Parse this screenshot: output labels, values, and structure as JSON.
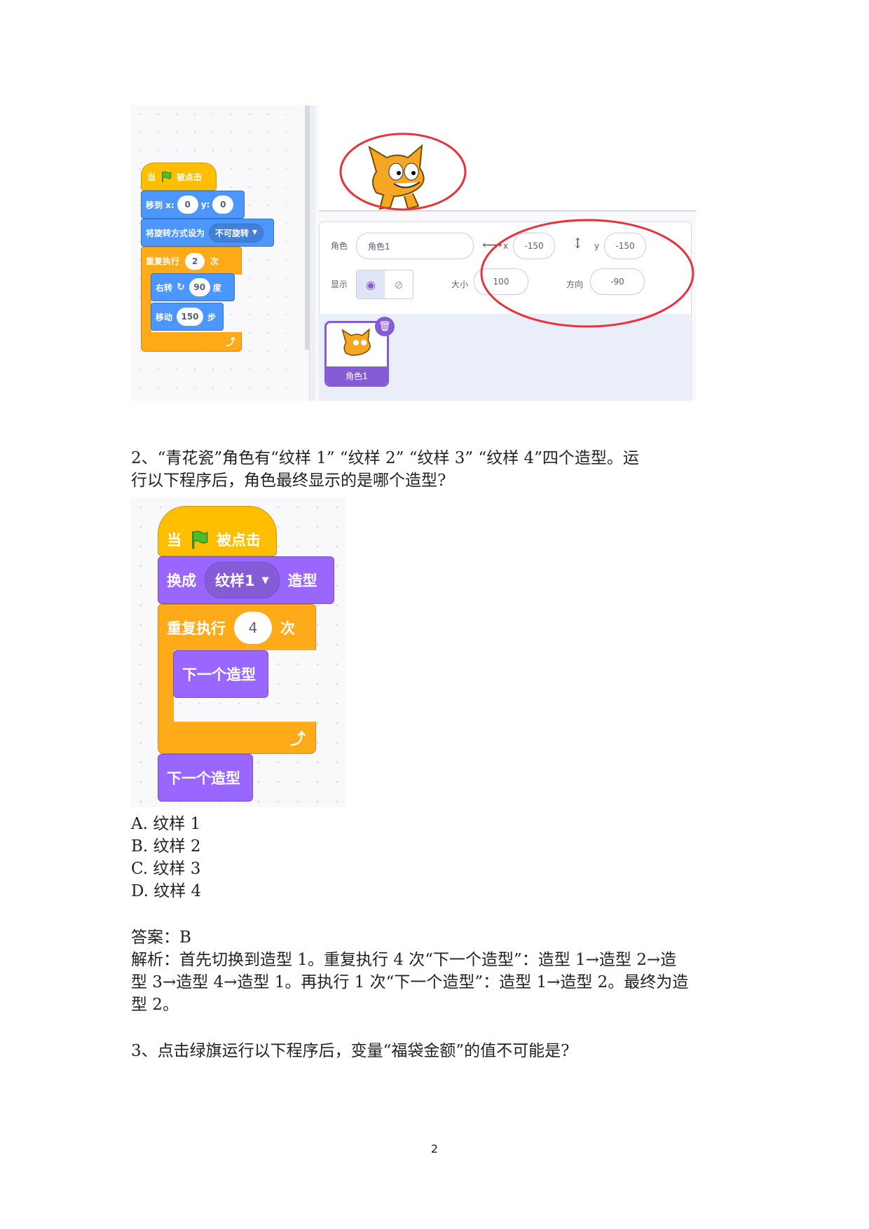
{
  "figure1": {
    "blocks": {
      "when_flag": {
        "pre": "当",
        "post": "被点击"
      },
      "goto": {
        "label": "移到 x:",
        "x": "0",
        "ylabel": "y:",
        "y": "0"
      },
      "rotation": {
        "label": "将旋转方式设为",
        "value": "不可旋转"
      },
      "repeat": {
        "label": "重复执行",
        "count": "2",
        "unit": "次"
      },
      "turn": {
        "label": "右转",
        "degrees": "90",
        "unit": "度"
      },
      "move": {
        "label": "移动",
        "steps": "150",
        "unit": "步"
      }
    },
    "sprite_info": {
      "sprite_label": "角色",
      "sprite_name": "角色1",
      "x_label": "x",
      "x_value": "-150",
      "y_label": "y",
      "y_value": "-150",
      "show_label": "显示",
      "size_label": "大小",
      "size_value": "100",
      "direction_label": "方向",
      "direction_value": "-90"
    },
    "sprite_tile": {
      "name": "角色1"
    }
  },
  "question2": {
    "text_line1": "2、“青花瓷”角色有“纹样 1” “纹样 2” “纹样 3” “纹样 4”四个造型。运",
    "text_line2": "行以下程序后，角色最终显示的是哪个造型?",
    "blocks": {
      "when_flag": {
        "pre": "当",
        "post": "被点击"
      },
      "switch": {
        "pre": "换成",
        "value": "纹样1",
        "post": "造型"
      },
      "repeat": {
        "label": "重复执行",
        "count": "4",
        "unit": "次"
      },
      "next_inner": "下一个造型",
      "next_outer": "下一个造型"
    },
    "options": [
      "A. 纹样 1",
      "B. 纹样 2",
      "C. 纹样 3",
      "D. 纹样 4"
    ],
    "answer": "答案：B",
    "analysis_line1": "解析：首先切换到造型 1。重复执行 4 次“下一个造型”：造型 1→造型 2→造",
    "analysis_line2": "型 3→造型 4→造型 1。再执行 1 次“下一个造型”：造型 1→造型 2。最终为造",
    "analysis_line3": "型 2。"
  },
  "question3": {
    "text": "3、点击绿旗运行以下程序后，变量“福袋金额”的值不可能是?"
  },
  "page_number": "2",
  "colors": {
    "events": "#ffbf00",
    "motion": "#4c97ff",
    "control": "#ffab19",
    "looks": "#9966ff",
    "highlight": "#e8333a"
  }
}
